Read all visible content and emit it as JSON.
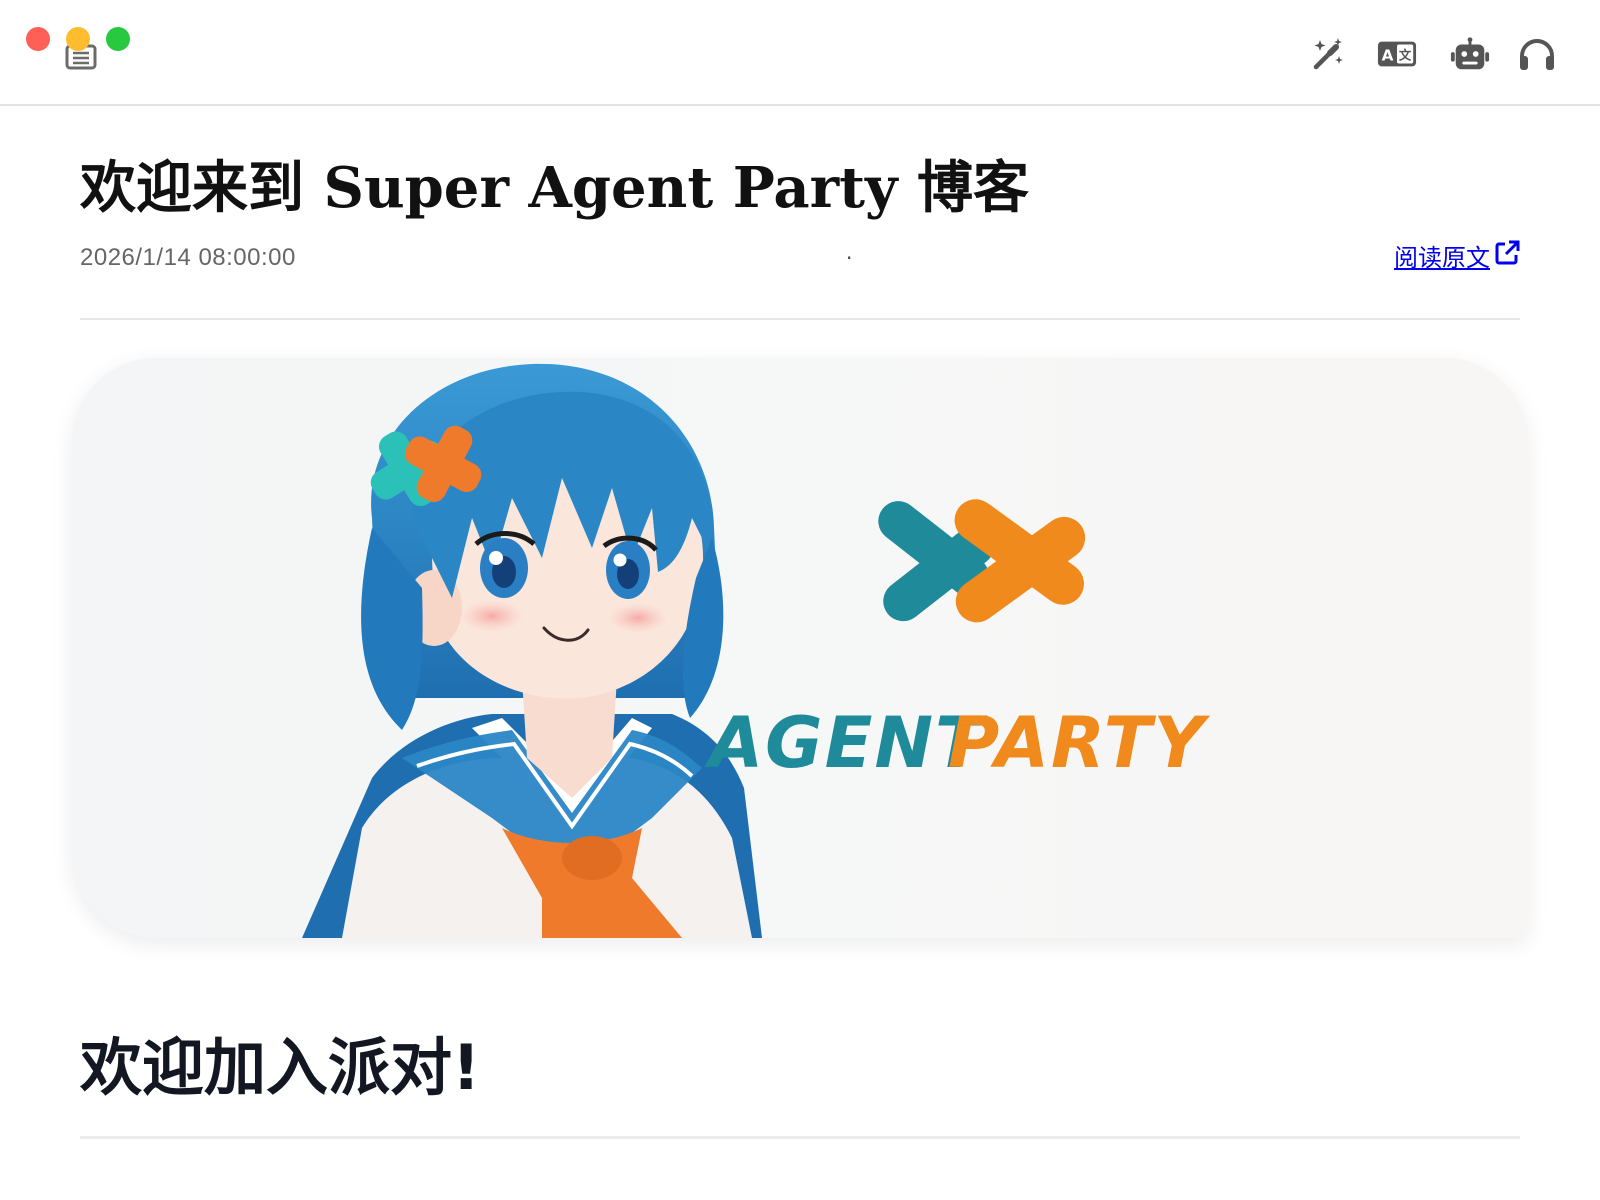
{
  "titlebar": {
    "window_controls": [
      "close",
      "minimize",
      "maximize"
    ],
    "reader_icon": "reader-icon",
    "toolbar_icons": [
      "magic-wand-icon",
      "translate-icon",
      "robot-icon",
      "headphones-icon"
    ]
  },
  "article": {
    "title": "欢迎来到 Super Agent Party 博客",
    "date": "2026/1/14 08:00:00",
    "separator": "·",
    "read_original": "阅读原文",
    "read_original_icon": "external-link-icon",
    "hero_image": {
      "logo_text_left": "AGENT",
      "logo_text_right": "PARTY",
      "colors": {
        "teal": "#1f8a9a",
        "orange": "#f08a1c",
        "hair_blue": "#2b86c5"
      }
    },
    "section_heading": "欢迎加入派对!"
  }
}
